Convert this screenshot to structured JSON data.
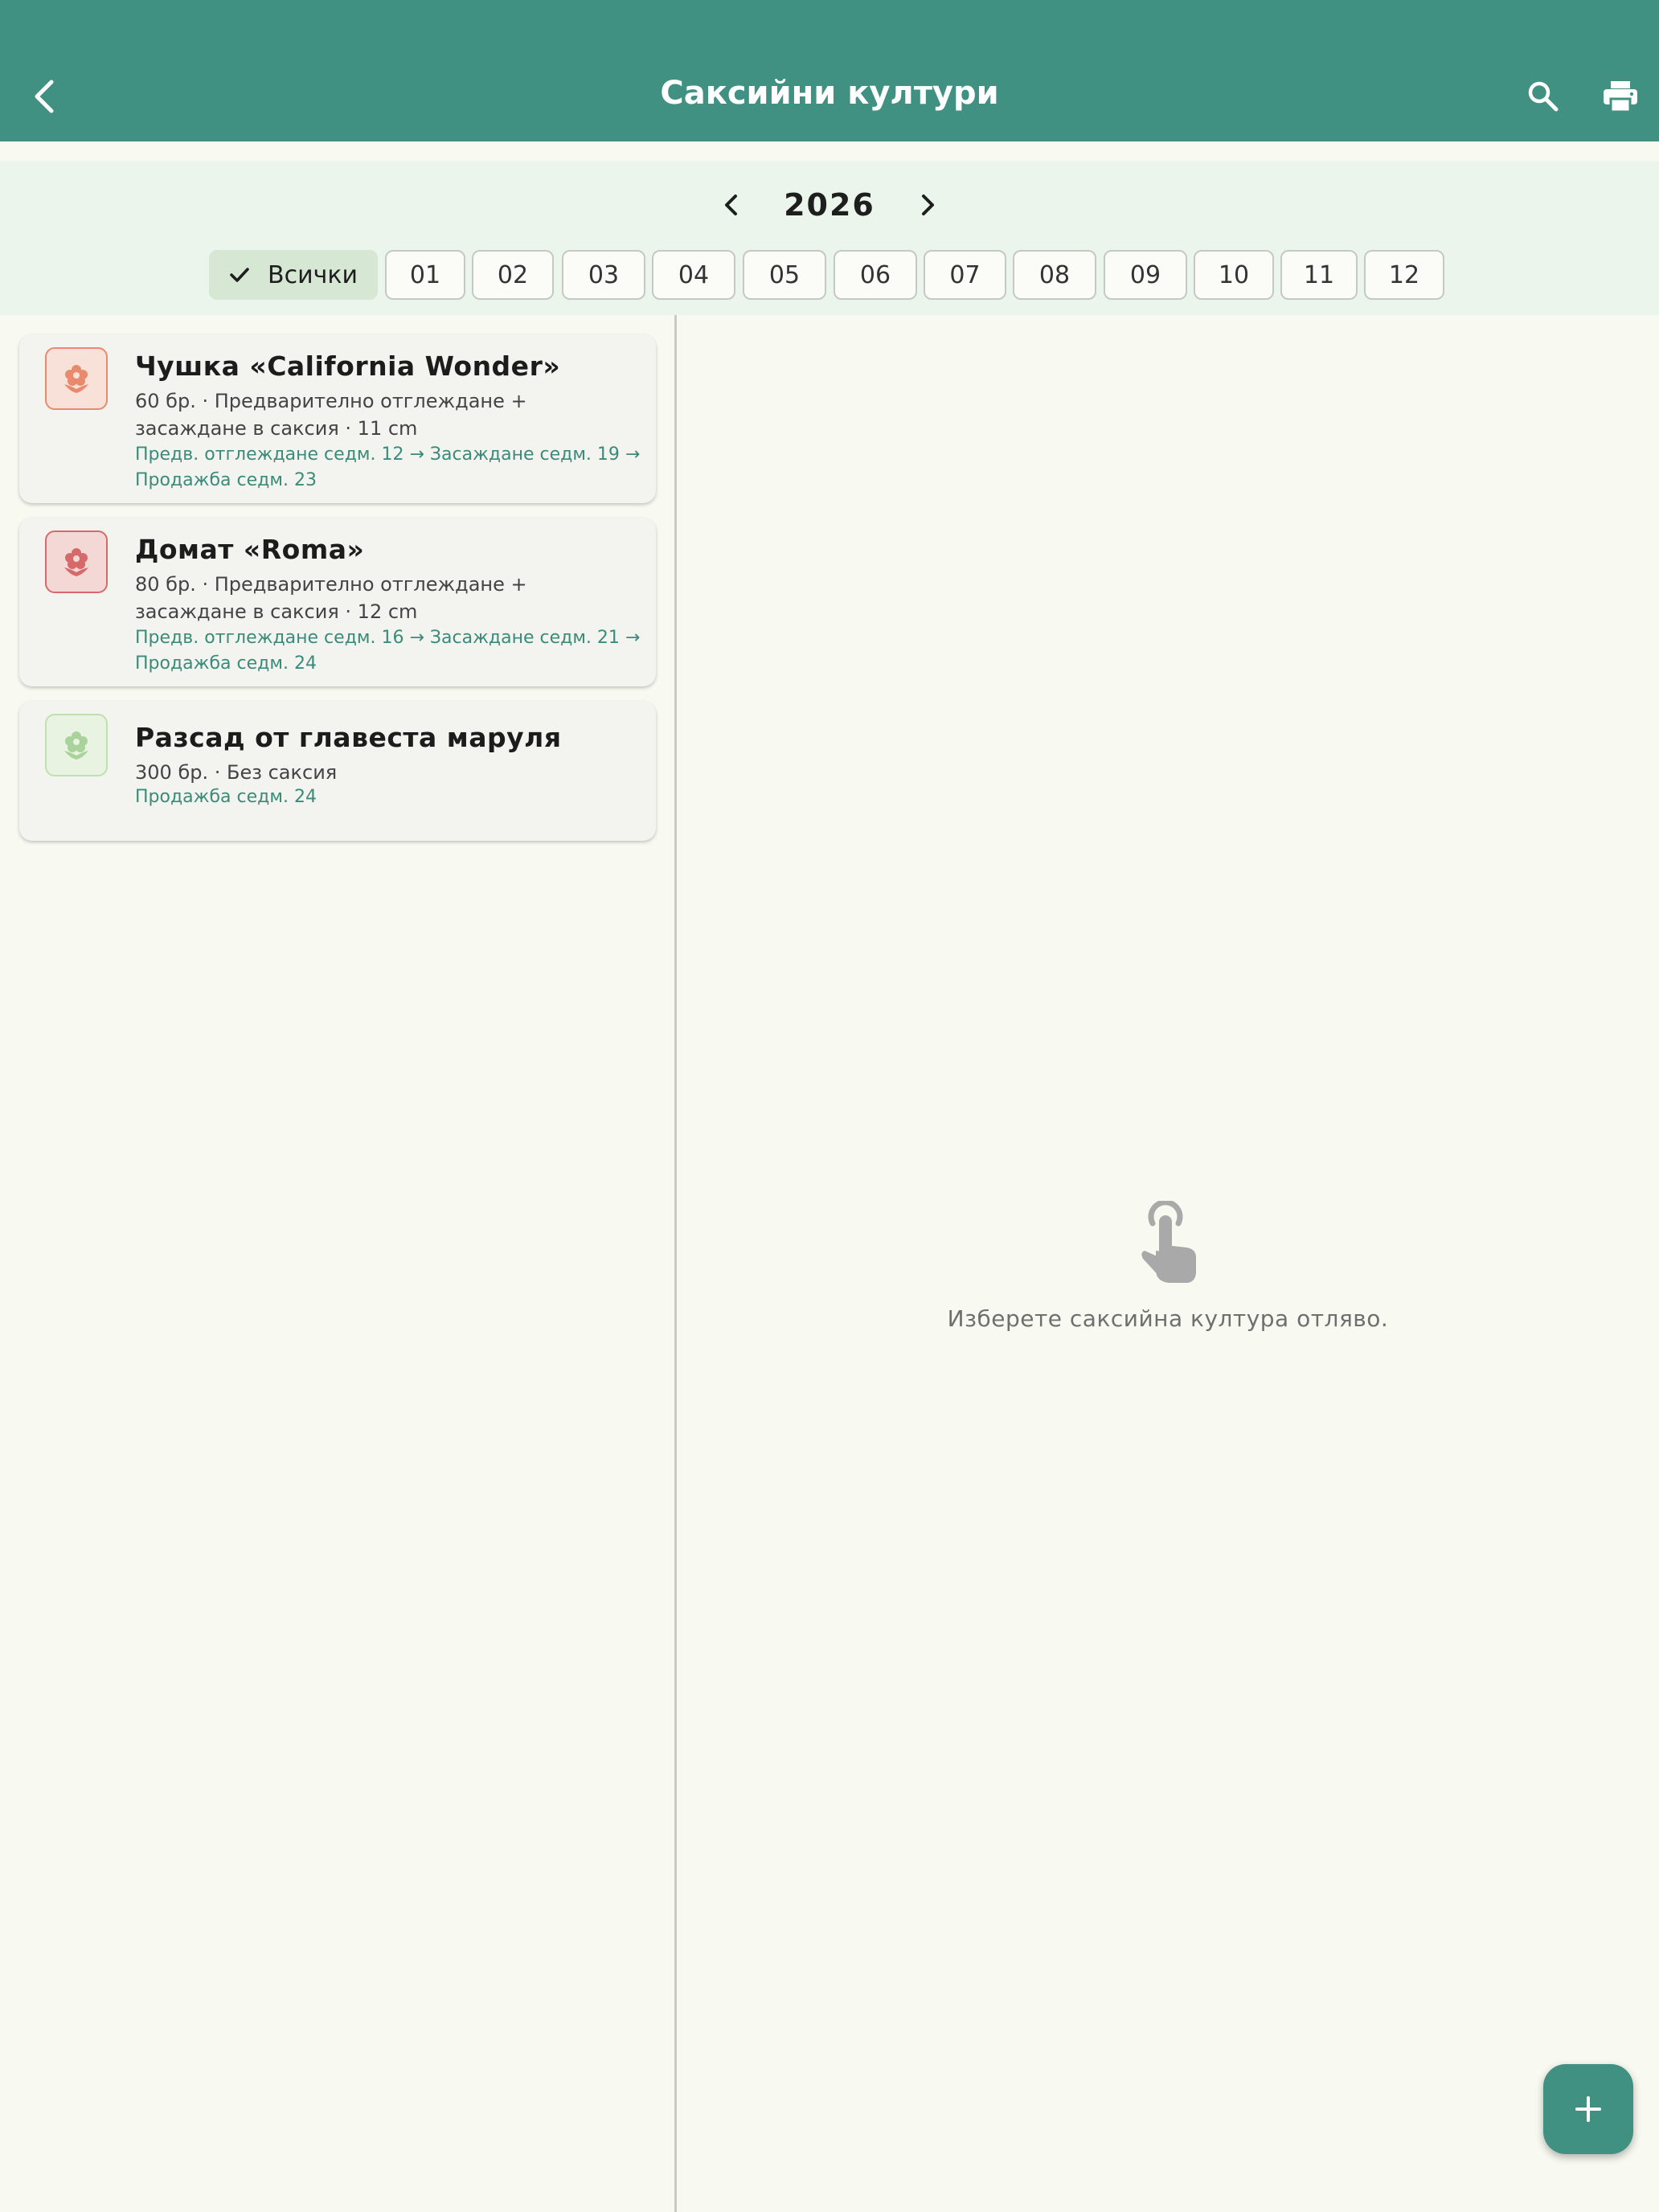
{
  "appbar": {
    "title": "Саксийни култури"
  },
  "filter": {
    "year": "2026",
    "all_label": "Всички",
    "months": [
      "01",
      "02",
      "03",
      "04",
      "05",
      "06",
      "07",
      "08",
      "09",
      "10",
      "11",
      "12"
    ]
  },
  "plants": [
    {
      "name": "Чушка «California Wonder»",
      "detail": "60 бр. · Предварително отглеждане + засаждане в саксия · 11 cm",
      "schedule": "Предв. отглеждане седм. 12 → Засаждане седм. 19 → Продажба седм. 23",
      "icon_color": "#e98a6c",
      "icon_bg": "#f7e1d8",
      "icon": "flower-icon"
    },
    {
      "name": "Домат «Roma»",
      "detail": "80 бр. · Предварително отглеждане + засаждане в саксия · 12 cm",
      "schedule": "Предв. отглеждане седм. 16 → Засаждане седм. 21 → Продажба седм. 24",
      "icon_color": "#d66a6a",
      "icon_bg": "#f3d8d6",
      "icon": "flower-icon"
    },
    {
      "name": "Разсад от главеста маруля",
      "detail": "300 бр. · Без саксия",
      "schedule": "Продажба седм. 24",
      "icon_color": "#a9d39a",
      "icon_bg": "#e9f3e1",
      "icon": "flower-icon"
    }
  ],
  "empty_state": {
    "message": "Изберете саксийна култура отляво.",
    "icon": "touch-icon"
  },
  "colors": {
    "primary": "#419182",
    "background": "#f8faf2",
    "filter_bg": "#ecf5ec",
    "schedule_text": "#3c8a7a"
  }
}
